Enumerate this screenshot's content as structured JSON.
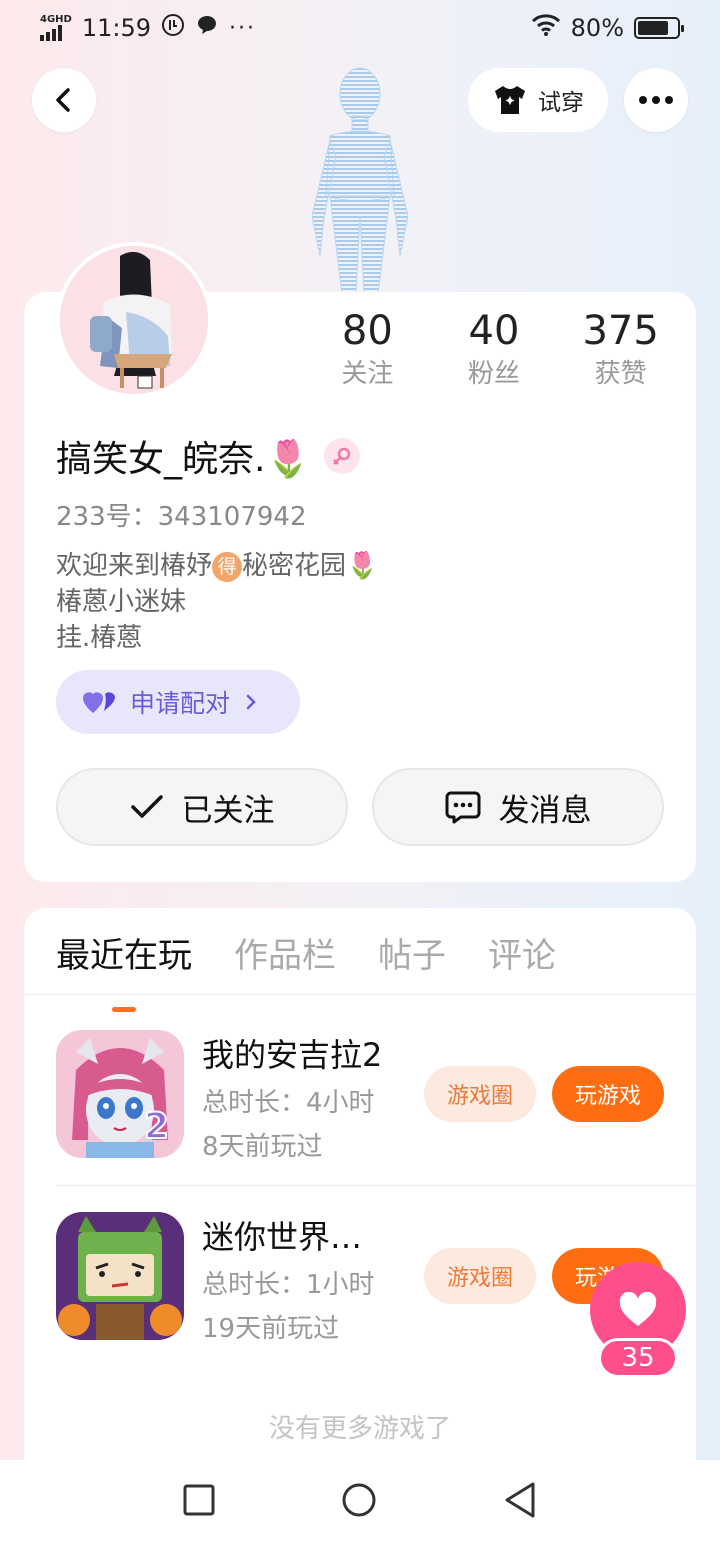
{
  "status_bar": {
    "network": "4GHD",
    "time": "11:59",
    "battery": "80%",
    "battery_level": 0.8,
    "overflow": "···"
  },
  "header": {
    "try_on_label": "试穿"
  },
  "profile": {
    "stats": [
      {
        "value": "80",
        "label": "关注"
      },
      {
        "value": "40",
        "label": "粉丝"
      },
      {
        "value": "375",
        "label": "获赞"
      }
    ],
    "username": "搞笑女_皖奈.🌷",
    "uid": "233号：343107942",
    "bio_line1_a": "欢迎来到椿妤",
    "bio_line1_badge": "得",
    "bio_line1_b": "秘密花园🌷",
    "bio_line2": "椿蒽小迷妹",
    "bio_line3": "挂.椿蒽",
    "pair_label": "申请配对",
    "followed_label": "已关注",
    "message_label": "发消息"
  },
  "tabs": [
    "最近在玩",
    "作品栏",
    "帖子",
    "评论"
  ],
  "games": [
    {
      "title": "我的安吉拉2",
      "duration": "总时长：4小时",
      "last_played": "8天前玩过",
      "circle_label": "游戏圈",
      "play_label": "玩游戏",
      "badge": "2"
    },
    {
      "title": "迷你世界…",
      "duration": "总时长：1小时",
      "last_played": "19天前玩过",
      "circle_label": "游戏圈",
      "play_label": "玩游戏"
    }
  ],
  "no_more": "没有更多游戏了",
  "like_count": "35",
  "colors": {
    "accent_orange": "#ff6d12",
    "pair_purple": "#6b5cd9",
    "like_pink": "#ff4f8a"
  }
}
